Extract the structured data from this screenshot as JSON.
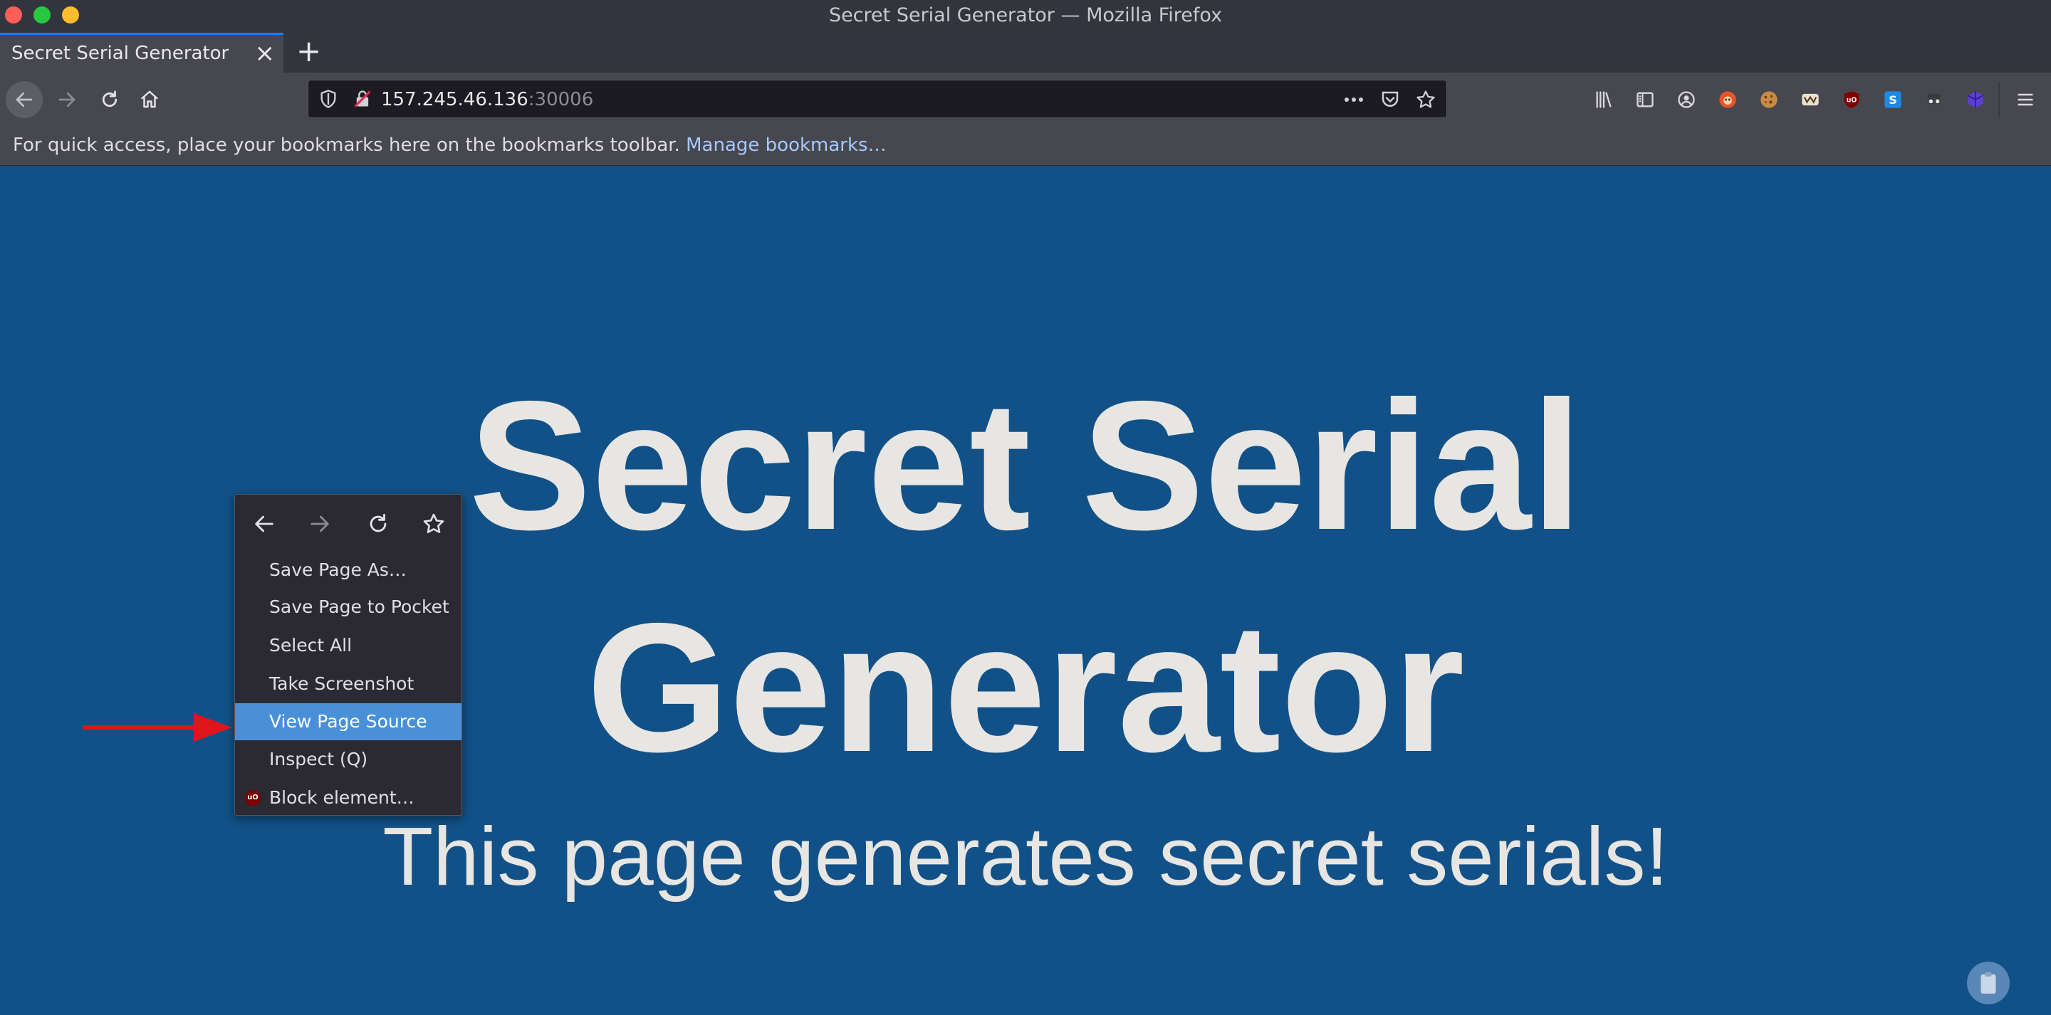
{
  "window": {
    "title": "Secret Serial Generator — Mozilla Firefox"
  },
  "tab": {
    "title": "Secret Serial Generator",
    "close": "×",
    "new_tab": "+"
  },
  "urlbar": {
    "host": "157.245.46.136",
    "port": ":30006"
  },
  "bookmarks_bar": {
    "message": "For quick access, place your bookmarks here on the bookmarks toolbar. ",
    "link": "Manage bookmarks…"
  },
  "page": {
    "heading_line1": "Secret Serial",
    "heading_line2": "Generator",
    "subheading": "This page generates secret serials!"
  },
  "context_menu": {
    "items": [
      {
        "label": "Save Page As…"
      },
      {
        "label": "Save Page to Pocket"
      },
      {
        "label": "Select All"
      },
      {
        "label": "Take Screenshot"
      },
      {
        "label": "View Page Source",
        "highlighted": true
      },
      {
        "label": "Inspect (Q)"
      },
      {
        "label": "Block element…"
      }
    ],
    "ublock_badge": "uO"
  },
  "colors": {
    "page_background": "#125187",
    "highlight": "#4a90d9",
    "annotation_arrow": "#e0151b"
  }
}
